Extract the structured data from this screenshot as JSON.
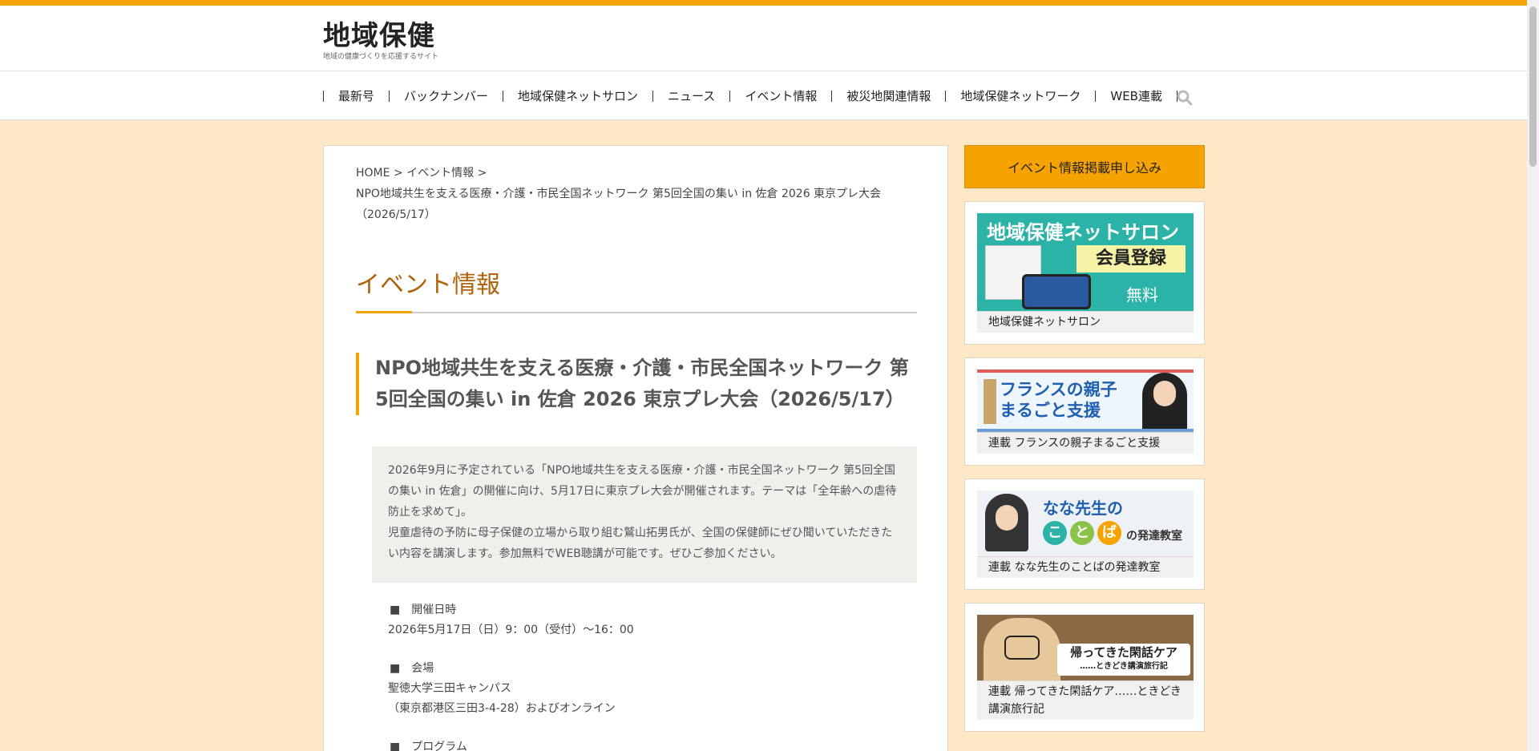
{
  "site": {
    "logo_title": "地域保健",
    "logo_subtitle": "地域の健康づくりを応援するサイト"
  },
  "nav": {
    "items": [
      {
        "label": "最新号"
      },
      {
        "label": "バックナンバー"
      },
      {
        "label": "地域保健ネットサロン"
      },
      {
        "label": "ニュース"
      },
      {
        "label": "イベント情報"
      },
      {
        "label": "被災地関連情報"
      },
      {
        "label": "地域保健ネットワーク"
      },
      {
        "label": "WEB連載"
      }
    ],
    "search_icon": "search-icon"
  },
  "breadcrumb": {
    "home": "HOME",
    "sep": ">",
    "category": "イベント情報",
    "current": "NPO地域共生を支える医療・介護・市民全国ネットワーク 第5回全国の集い in 佐倉 2026 東京プレ大会（2026/5/17）"
  },
  "main": {
    "page_title": "イベント情報",
    "event_title": "NPO地域共生を支える医療・介護・市民全国ネットワーク 第5回全国の集い in 佐倉 2026 東京プレ大会（2026/5/17）",
    "summary_p1": "2026年9月に予定されている「NPO地域共生を支える医療・介護・市民全国ネットワーク 第5回全国の集い in 佐倉」の開催に向け、5月17日に東京プレ大会が開催されます。テーマは「全年齢への虐待防止を求めて」。",
    "summary_p2": "児童虐待の予防に母子保健の立場から取り組む鷲山拓男氏が、全国の保健師にぜひ聞いていただきたい内容を講演します。参加無料でWEB聴講が可能です。ぜひご参加ください。",
    "date_label": "開催日時",
    "date_value": "2026年5月17日（日）9：00（受付）～16：00",
    "venue_label": "会場",
    "venue_value1": "聖徳大学三田キャンパス",
    "venue_value2": "（東京都港区三田3-4-28）およびオンライン",
    "program_label": "プログラム"
  },
  "sidebar": {
    "apply_label": "イベント情報掲載申し込み",
    "cards": [
      {
        "banner_line1": "地域保健ネットサロン",
        "banner_line2": "会員登録",
        "banner_line3": "無料",
        "caption": "地域保健ネットサロン"
      },
      {
        "banner_line1": "フランスの親子",
        "banner_line2": "まるごと支援",
        "caption": "連載 フランスの親子まるごと支援"
      },
      {
        "banner_line1": "なな先生の",
        "banner_chars": [
          "こ",
          "と",
          "ば"
        ],
        "banner_line2": "の発達教室",
        "caption": "連載 なな先生のことばの発達教室"
      },
      {
        "banner_line1": "帰ってきた閑話ケア",
        "banner_line2": "……ときどき講演旅行記",
        "caption": "連載 帰ってきた閑話ケア……ときどき講演旅行記"
      }
    ]
  },
  "colors": {
    "accent": "#f5a300",
    "background": "#fde8c6",
    "title": "#b0620a",
    "teal": "#2bb3a8"
  }
}
